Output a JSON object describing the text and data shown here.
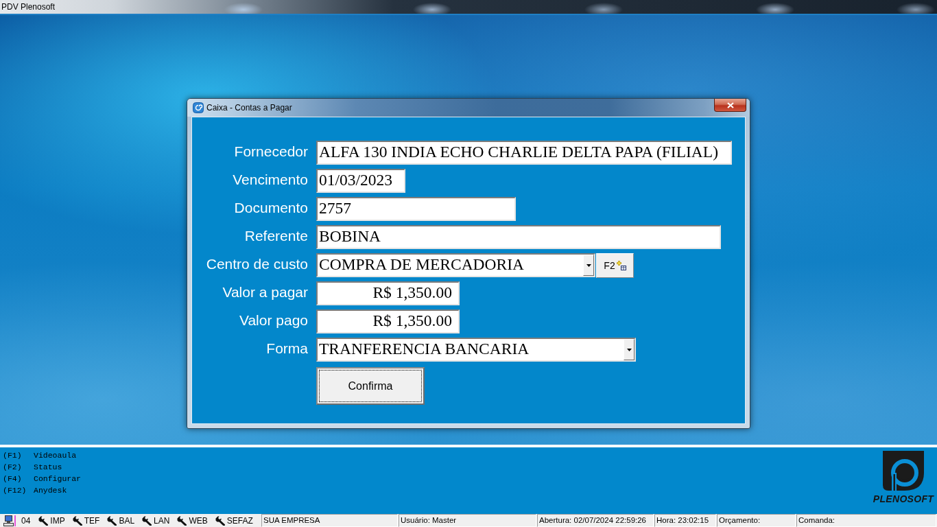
{
  "window": {
    "title": "PDV Plenosoft"
  },
  "dialog": {
    "title": "Caixa - Contas a Pagar",
    "fields": [
      {
        "label": "Fornecedor",
        "value": "ALFA 130 INDIA ECHO CHARLIE DELTA PAPA (FILIAL)",
        "kind": "text"
      },
      {
        "label": "Vencimento",
        "value": "01/03/2023",
        "kind": "text"
      },
      {
        "label": "Documento",
        "value": "2757",
        "kind": "text"
      },
      {
        "label": "Referente",
        "value": "BOBINA",
        "kind": "text"
      },
      {
        "label": "Centro de custo",
        "value": "COMPRA DE MERCADORIA",
        "kind": "combo",
        "button": "F2"
      },
      {
        "label": "Valor a pagar",
        "value": "R$ 1,350.00",
        "kind": "currency"
      },
      {
        "label": "Valor pago",
        "value": "R$ 1,350.00",
        "kind": "currency"
      },
      {
        "label": "Forma",
        "value": "TRANFERENCIA BANCARIA",
        "kind": "combo"
      }
    ],
    "submit": {
      "label": "Confirma",
      "focused": true
    }
  },
  "shortcuts": [
    {
      "key": "(F1)",
      "label": "Videoaula"
    },
    {
      "key": "(F2)",
      "label": "Status"
    },
    {
      "key": "(F4)",
      "label": "Configurar"
    },
    {
      "key": "(F12)",
      "label": "Anydesk"
    }
  ],
  "logo": {
    "text": "PLENOSOFT"
  },
  "status_bar": {
    "terminal": "04",
    "services": [
      "IMP",
      "TEF",
      "BAL",
      "LAN",
      "WEB",
      "SEFAZ"
    ],
    "panels": [
      "SUA EMPRESA",
      "Usuário: Master",
      "Abertura: 02/07/2024 22:59:26",
      "Hora: 23:02:15",
      "Orçamento:",
      "Comanda:"
    ]
  }
}
